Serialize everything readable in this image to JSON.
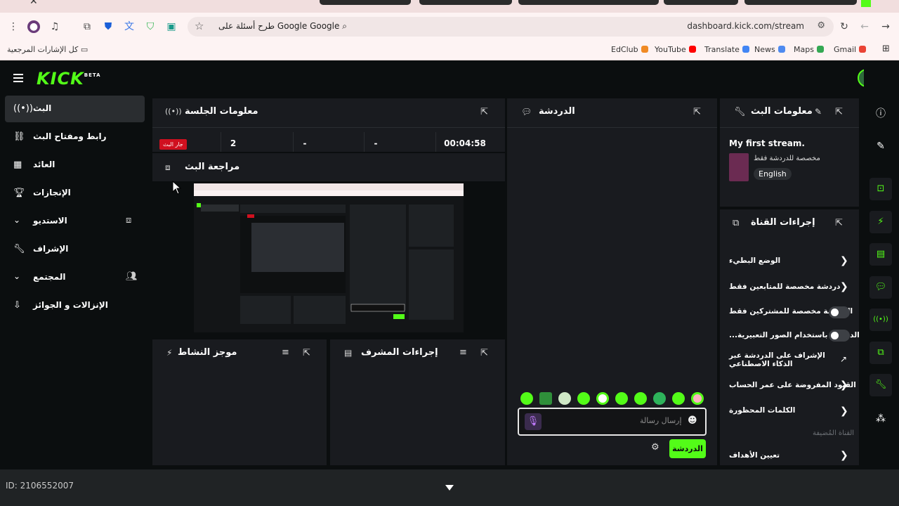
{
  "browser": {
    "url": "dashboard.kick.com/stream",
    "search_chip": "طرح أسئلة على Google",
    "bookmarks_folder": "كل الإشارات المرجعية",
    "bookmarks": [
      "EdClub",
      "YouTube",
      "Translate",
      "News",
      "Maps",
      "Gmail"
    ]
  },
  "app": {
    "logo": "KICK",
    "logo_badge": "BETA",
    "accent": "#53fc18"
  },
  "sidebar": {
    "items": [
      {
        "label": "البث",
        "icon": "broadcast-icon"
      },
      {
        "label": "رابط ومفتاح البث",
        "icon": "link-icon"
      },
      {
        "label": "العائد",
        "icon": "chart-icon"
      },
      {
        "label": "الإنجازات",
        "icon": "trophy-icon"
      },
      {
        "label": "الاستديو",
        "icon": "studio-icon"
      },
      {
        "label": "الإشراف",
        "icon": "wrench-icon"
      },
      {
        "label": "المجتمع",
        "icon": "users-icon"
      },
      {
        "label": "الإنزالات و الجوائز",
        "icon": "drop-icon"
      }
    ]
  },
  "session": {
    "title": "معلومات الجلسة",
    "live_badge": "جار البث",
    "values": [
      "2",
      "-",
      "-",
      "00:04:58"
    ]
  },
  "review": {
    "title": "مراجعة البث"
  },
  "activity": {
    "title": "موجز النشاط"
  },
  "modactions": {
    "title": "إجراءات المشرف"
  },
  "chat": {
    "title": "الدردشة",
    "placeholder": "إرسال رسالة",
    "send_label": "الدردشة"
  },
  "streaminfo": {
    "title": "معلومات البث",
    "stream_title": "My first stream.",
    "category": "مخصصة للدردشة فقط",
    "language": "English"
  },
  "channel_actions": {
    "title": "إجراءات القناة",
    "rows": [
      {
        "label": "الوضع البطيء",
        "type": "chevron"
      },
      {
        "label": "دردشة مخصصة للمتابعين فقط",
        "type": "chevron"
      },
      {
        "label": "الدردشة مخصصة للمشتركين فقط",
        "type": "toggle"
      },
      {
        "label": "...الدردشة باستخدام الصور التعبيرية",
        "type": "toggle"
      },
      {
        "label": "الإشراف على الدردشة عبر الذكاء الاصطناعي",
        "type": "external"
      },
      {
        "label": "القيود المفروضة على عمر الحساب",
        "type": "chevron"
      },
      {
        "label": "الكلمات المحظورة",
        "type": "chevron"
      }
    ],
    "host_hint": "القناة المُضيفة",
    "goals": "تعيين الأهداف"
  },
  "footer": {
    "id_text": "ID: 2106552007"
  }
}
